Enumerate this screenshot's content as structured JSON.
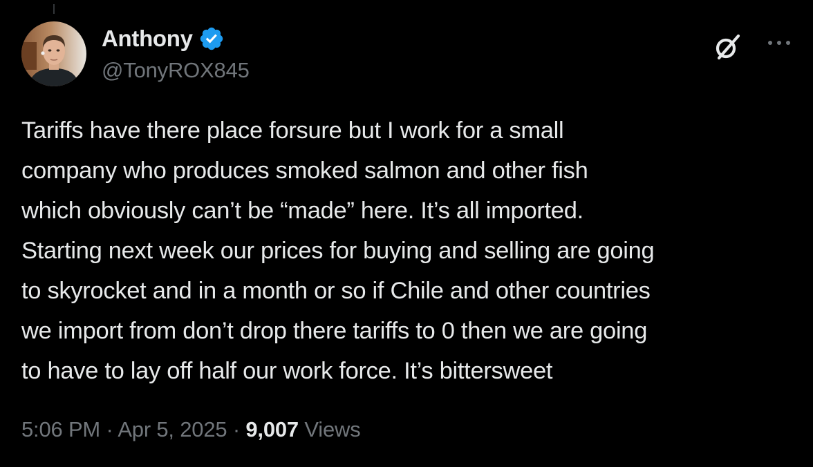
{
  "post": {
    "author": {
      "display_name": "Anthony",
      "handle": "@TonyROX845",
      "verified": true,
      "verified_color": "#1d9bf0"
    },
    "text": "Tariffs have there place forsure but I work for a small\ncompany who produces smoked salmon and other fish\nwhich obviously can’t be “made” here. It’s all imported.\nStarting next week our prices for buying and selling are going\nto skyrocket and in a month or so if Chile and other countries\nwe import from don’t drop there tariffs to 0 then we are going\nto have to lay off half our work force. It’s bittersweet",
    "meta": {
      "time": "5:06 PM",
      "separator": "·",
      "date": "Apr 5, 2025",
      "views_count": "9,007",
      "views_label": "Views"
    },
    "actions": {
      "grok_icon": "grok-icon",
      "more_icon": "more-icon"
    }
  },
  "colors": {
    "background": "#000000",
    "primary_text": "#e7e9ea",
    "secondary_text": "#71767b",
    "accent": "#1d9bf0"
  }
}
